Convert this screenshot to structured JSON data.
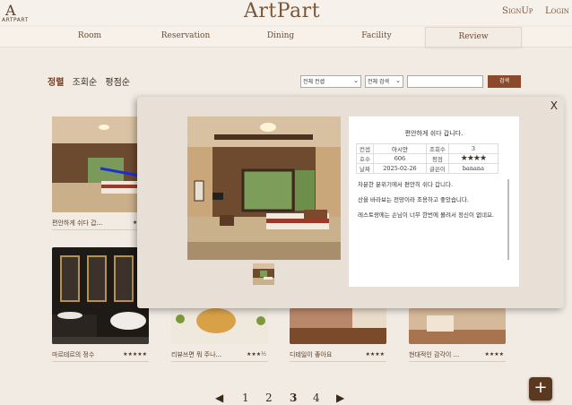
{
  "header": {
    "logo_mark": "A",
    "logo_text": "ARTPART",
    "brand": "ArtPart",
    "signup": "SignUp",
    "login": "Login"
  },
  "nav": [
    "Room",
    "Reservation",
    "Dining",
    "Facility",
    "Review"
  ],
  "sort": {
    "options": [
      "정렬",
      "조회순",
      "평점순"
    ]
  },
  "search": {
    "select1": "전체 컨셉",
    "select2": "전체 검색",
    "button": "검색"
  },
  "cards": [
    {
      "caption": "편안하게 쉬다 갑...",
      "stars": "★★★"
    },
    {
      "caption": "마르테르의 정수",
      "stars": "★★★★★"
    },
    {
      "caption": "리뷰쓰면 뭐 주나...",
      "stars": "★★★½"
    },
    {
      "caption": "디테일이 좋아요",
      "stars": "★★★★"
    },
    {
      "caption": "현대적인 감각이 ...",
      "stars": "★★★★"
    }
  ],
  "modal": {
    "close": "X",
    "title": "편안하게 쉬다 갑니다.",
    "info": {
      "concept_label": "컨셉",
      "concept": "아시안",
      "views_label": "조회수",
      "views": "3",
      "room_label": "호수",
      "room": "606",
      "rating_label": "평점",
      "rating": "★★★★",
      "date_label": "날짜",
      "date": "2025-02-26",
      "author_label": "글쓴이",
      "author": "banana"
    },
    "body": [
      "차분한 분위기에서 편안히 쉬다 갑니다.",
      "산을 바라보는 전망이라 조용하고 좋았습니다.",
      "레스토랑에는 손님이 너무 한번에 몰려서 정신이 없네요."
    ]
  },
  "pager": {
    "prev": "◀",
    "pages": [
      "1",
      "2",
      "3",
      "4"
    ],
    "current": "3",
    "next": "▶"
  },
  "fab": "+",
  "colors": {
    "accent": "#8b4a2b",
    "bg": "#f2ebe4",
    "brand": "#7a5638"
  }
}
